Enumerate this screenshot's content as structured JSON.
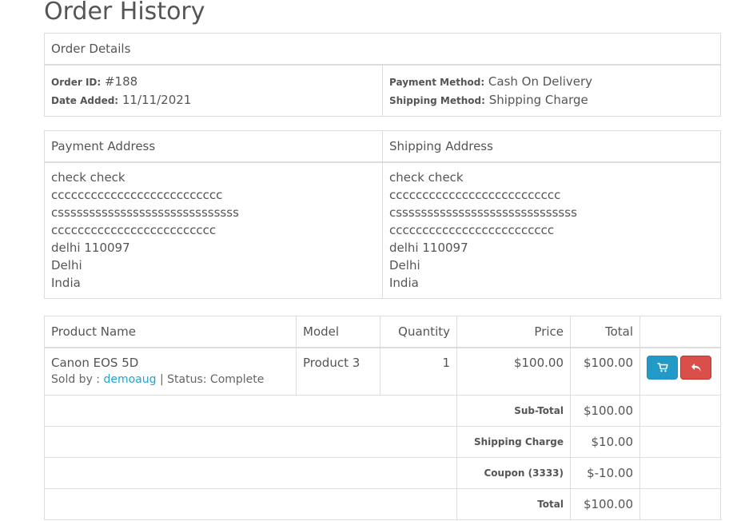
{
  "page": {
    "title": "Order History"
  },
  "details": {
    "heading": "Order Details",
    "order_id_label": "Order ID:",
    "order_id": "#188",
    "date_added_label": "Date Added:",
    "date_added": "11/11/2021",
    "payment_method_label": "Payment Method:",
    "payment_method": "Cash On Delivery",
    "shipping_method_label": "Shipping Method:",
    "shipping_method": "Shipping Charge"
  },
  "addresses": {
    "payment_heading": "Payment Address",
    "shipping_heading": "Shipping Address",
    "payment": [
      "check check",
      "cccccccccccccccccccccccccc",
      "csssssssssssssssssssssssssssss",
      "ccccccccccccccccccccccccc",
      "delhi 110097",
      "Delhi",
      "India"
    ],
    "shipping": [
      "check check",
      "cccccccccccccccccccccccccc",
      "csssssssssssssssssssssssssssss",
      "ccccccccccccccccccccccccc",
      "delhi 110097",
      "Delhi",
      "India"
    ]
  },
  "products": {
    "headers": {
      "name": "Product Name",
      "model": "Model",
      "quantity": "Quantity",
      "price": "Price",
      "total": "Total"
    },
    "rows": [
      {
        "name": "Canon EOS 5D",
        "sold_by_label": "Sold by : ",
        "seller": "demoaug",
        "separator": " | ",
        "status": "Status: Complete",
        "model": "Product 3",
        "quantity": "1",
        "price": "$100.00",
        "total": "$100.00",
        "cart_icon": "cart-icon",
        "return_icon": "reply-icon"
      }
    ]
  },
  "totals": [
    {
      "label": "Sub-Total",
      "value": "$100.00"
    },
    {
      "label": "Shipping Charge",
      "value": "$10.00"
    },
    {
      "label": "Coupon (3333)",
      "value": "$-10.00"
    },
    {
      "label": "Total",
      "value": "$100.00"
    }
  ],
  "colors": {
    "cart_button": "#229ac8",
    "return_button": "#da4f49",
    "link": "#23a1d1",
    "border": "#dddddd"
  }
}
